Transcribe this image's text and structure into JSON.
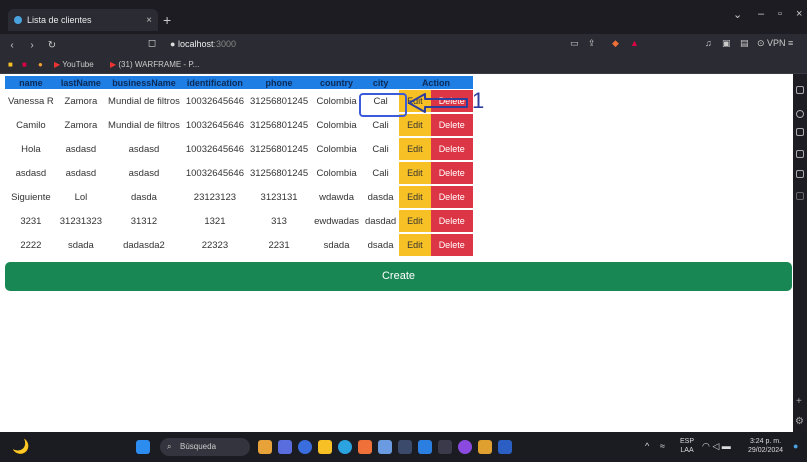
{
  "browser": {
    "tab_title": "Lista de clientes",
    "tab_close": "×",
    "new_tab": "+",
    "url_host": "localhost",
    "url_port": ":3000",
    "bookmarks": [
      "YouTube",
      "(31) WARFRAME - P..."
    ],
    "vpn": "VPN"
  },
  "table": {
    "headers": [
      "name",
      "lastName",
      "businessName",
      "identification",
      "phone",
      "country",
      "city",
      "Action"
    ],
    "rows": [
      [
        "Vanessa R",
        "Zamora",
        "Mundial de filtros",
        "10032645646",
        "31256801245",
        "Colombia",
        "Cal"
      ],
      [
        "Camilo",
        "Zamora",
        "Mundial de filtros",
        "10032645646",
        "31256801245",
        "Colombia",
        "Cali"
      ],
      [
        "Hola",
        "asdasd",
        "asdasd",
        "10032645646",
        "31256801245",
        "Colombia",
        "Cali"
      ],
      [
        "asdasd",
        "asdasd",
        "asdasd",
        "10032645646",
        "31256801245",
        "Colombia",
        "Cali"
      ],
      [
        "Siguiente",
        "Lol",
        "dasda",
        "23123123",
        "3123131",
        "wdawda",
        "dasda"
      ],
      [
        "3231",
        "31231323",
        "31312",
        "1321",
        "313",
        "ewdwadas",
        "dasdad"
      ],
      [
        "2222",
        "sdada",
        "dadasda2",
        "22323",
        "2231",
        "sdada",
        "dsada"
      ]
    ],
    "edit_label": "Edit",
    "delete_label": "Delete"
  },
  "annotation": {
    "number": "1"
  },
  "create_label": "Create",
  "taskbar": {
    "search_placeholder": "Búsqueda",
    "lang_top": "ESP",
    "lang_bottom": "LAA",
    "time": "3:24 p. m.",
    "date": "29/02/2024"
  },
  "colors": {
    "header_bg": "#1e7ee4",
    "edit": "#f7c024",
    "delete": "#dc3545",
    "create": "#198754",
    "annotation": "#3b5bdb"
  }
}
